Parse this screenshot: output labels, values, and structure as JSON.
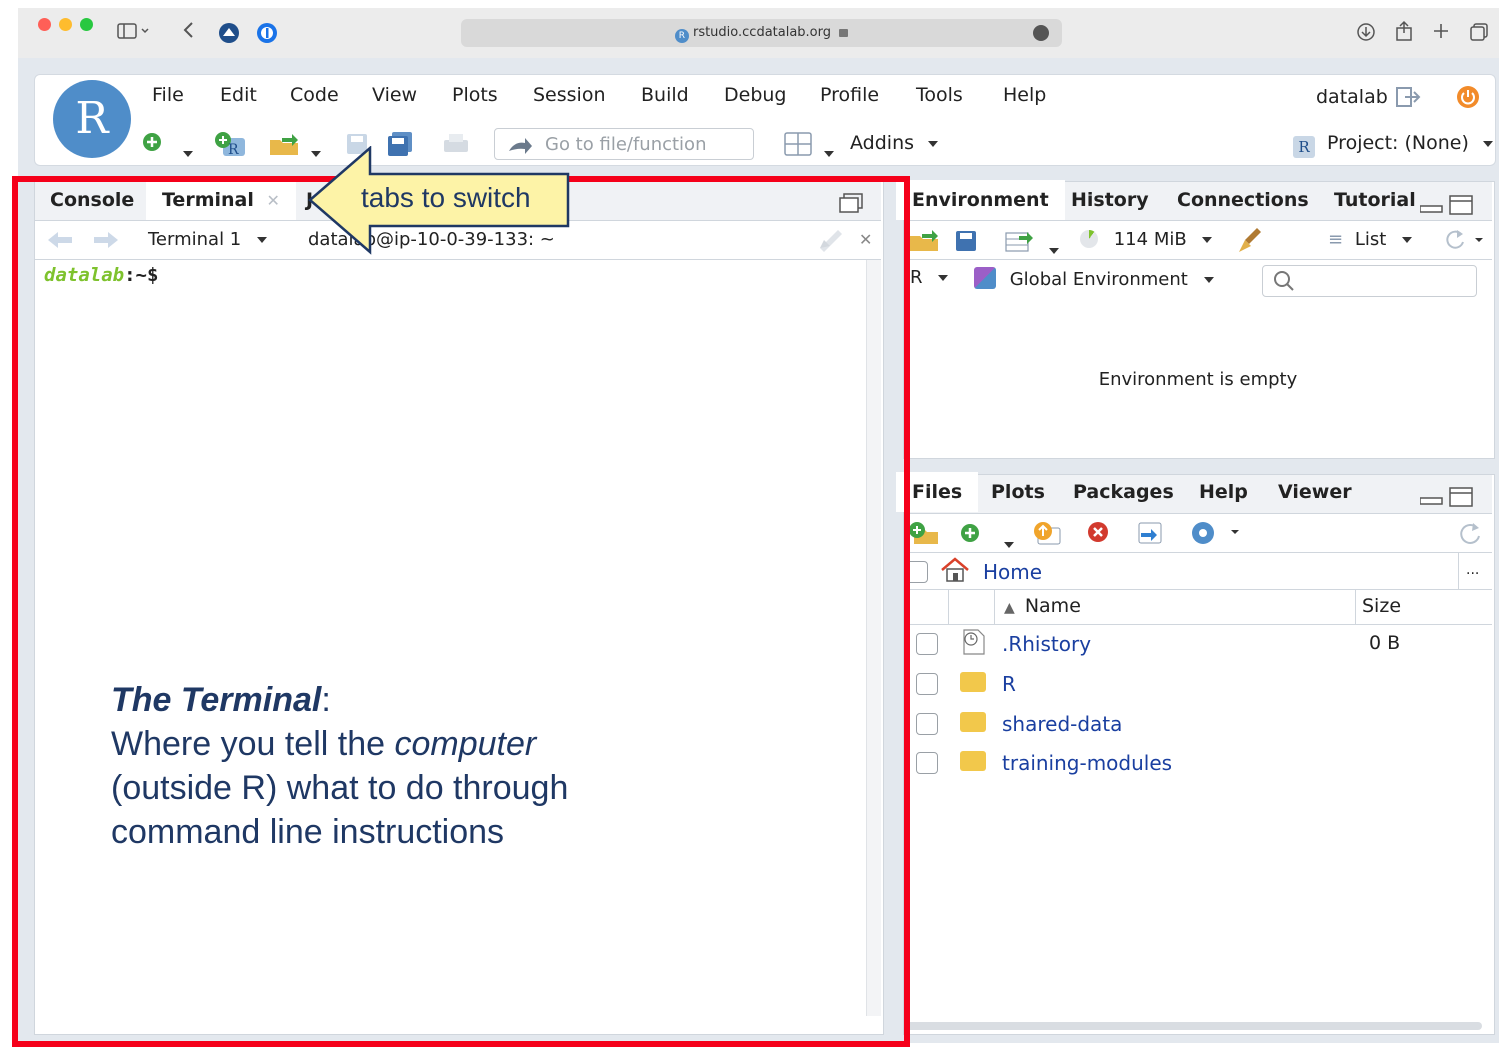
{
  "browser": {
    "url": "rstudio.ccdatalab.org",
    "url_icon": "rstudio-favicon-icon",
    "lock_icon": "lock-icon"
  },
  "menubar": {
    "items": [
      "File",
      "Edit",
      "Code",
      "View",
      "Plots",
      "Session",
      "Build",
      "Debug",
      "Profile",
      "Tools",
      "Help"
    ],
    "user": "datalab"
  },
  "toolbar": {
    "goto_placeholder": "Go to file/function",
    "addins_label": "Addins",
    "project_label": "Project: (None)"
  },
  "left_pane": {
    "tabs": [
      "Console",
      "Terminal",
      "J"
    ],
    "active_tab": "Terminal",
    "terminal_selector": "Terminal 1",
    "terminal_path": "datalab@ip-10-0-39-133: ~",
    "prompt_user": "datalab",
    "prompt_suffix": ":~$"
  },
  "callout": {
    "arrow_label": "tabs to switch",
    "description_title": "The Terminal",
    "description_colon": ":",
    "description_line1_pre": "Where you tell the ",
    "description_line1_em": "computer",
    "description_line2": "(outside R) what to do through",
    "description_line3": "command line instructions"
  },
  "env_pane": {
    "tabs": [
      "Environment",
      "History",
      "Connections",
      "Tutorial"
    ],
    "memory": "114 MiB",
    "list_label": "List",
    "lang_label": "R",
    "scope_label": "Global Environment",
    "empty_message": "Environment is empty"
  },
  "files_pane": {
    "tabs": [
      "Files",
      "Plots",
      "Packages",
      "Help",
      "Viewer"
    ],
    "breadcrumb": "Home",
    "more_label": "...",
    "column_name": "Name",
    "column_size": "Size",
    "files": [
      {
        "name": ".Rhistory",
        "size": "0 B",
        "icon": "history-file-icon"
      },
      {
        "name": "R",
        "size": "",
        "icon": "folder-icon"
      },
      {
        "name": "shared-data",
        "size": "",
        "icon": "folder-icon"
      },
      {
        "name": "training-modules",
        "size": "",
        "icon": "folder-icon"
      }
    ]
  },
  "colors": {
    "annotation_red": "#f5001a",
    "callout_yellow": "#fdf3a7",
    "prompt_green": "#7ec22d",
    "annotation_text": "#1f3864"
  }
}
